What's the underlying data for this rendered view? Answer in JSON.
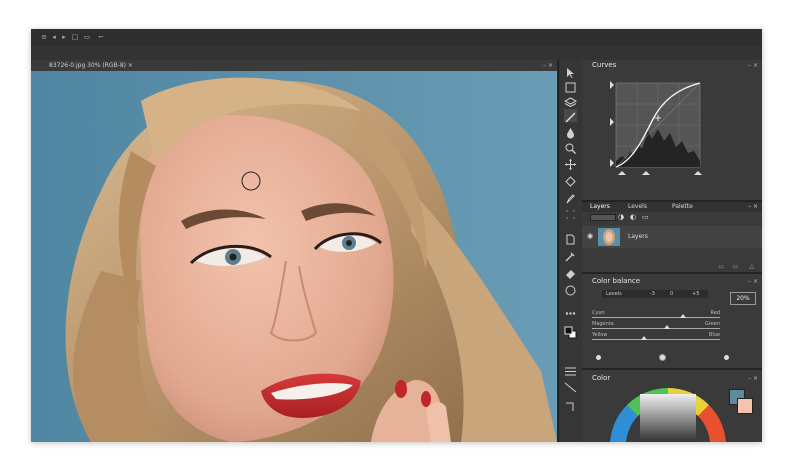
{
  "document": {
    "tab_title": "83726-0.jpg 30% (RGB-8) ×",
    "controls": "– ×"
  },
  "panels": {
    "curves": {
      "title": "Curves",
      "controls": "– ×"
    },
    "tabs": {
      "layers": "Layers",
      "levels": "Levels",
      "palette": "Palette",
      "controls": "– ×"
    },
    "layers": {
      "layer_name": "Layers"
    },
    "color_balance": {
      "title": "Color balance",
      "controls": "– ×",
      "levels_label": "Levels",
      "val1": "-3",
      "val2": "0",
      "val3": "+5",
      "percent": "20%",
      "cyan": "Cyan",
      "red": "Red",
      "magenta": "Magenta",
      "green": "Green",
      "yellow": "Yellow",
      "blue": "Blue"
    },
    "color": {
      "title": "Color",
      "controls": "– ×"
    }
  },
  "colors": {
    "foreground": "#5e8a9c",
    "background": "#f4c4b1",
    "canvas_bg": "#5d8ea8"
  }
}
